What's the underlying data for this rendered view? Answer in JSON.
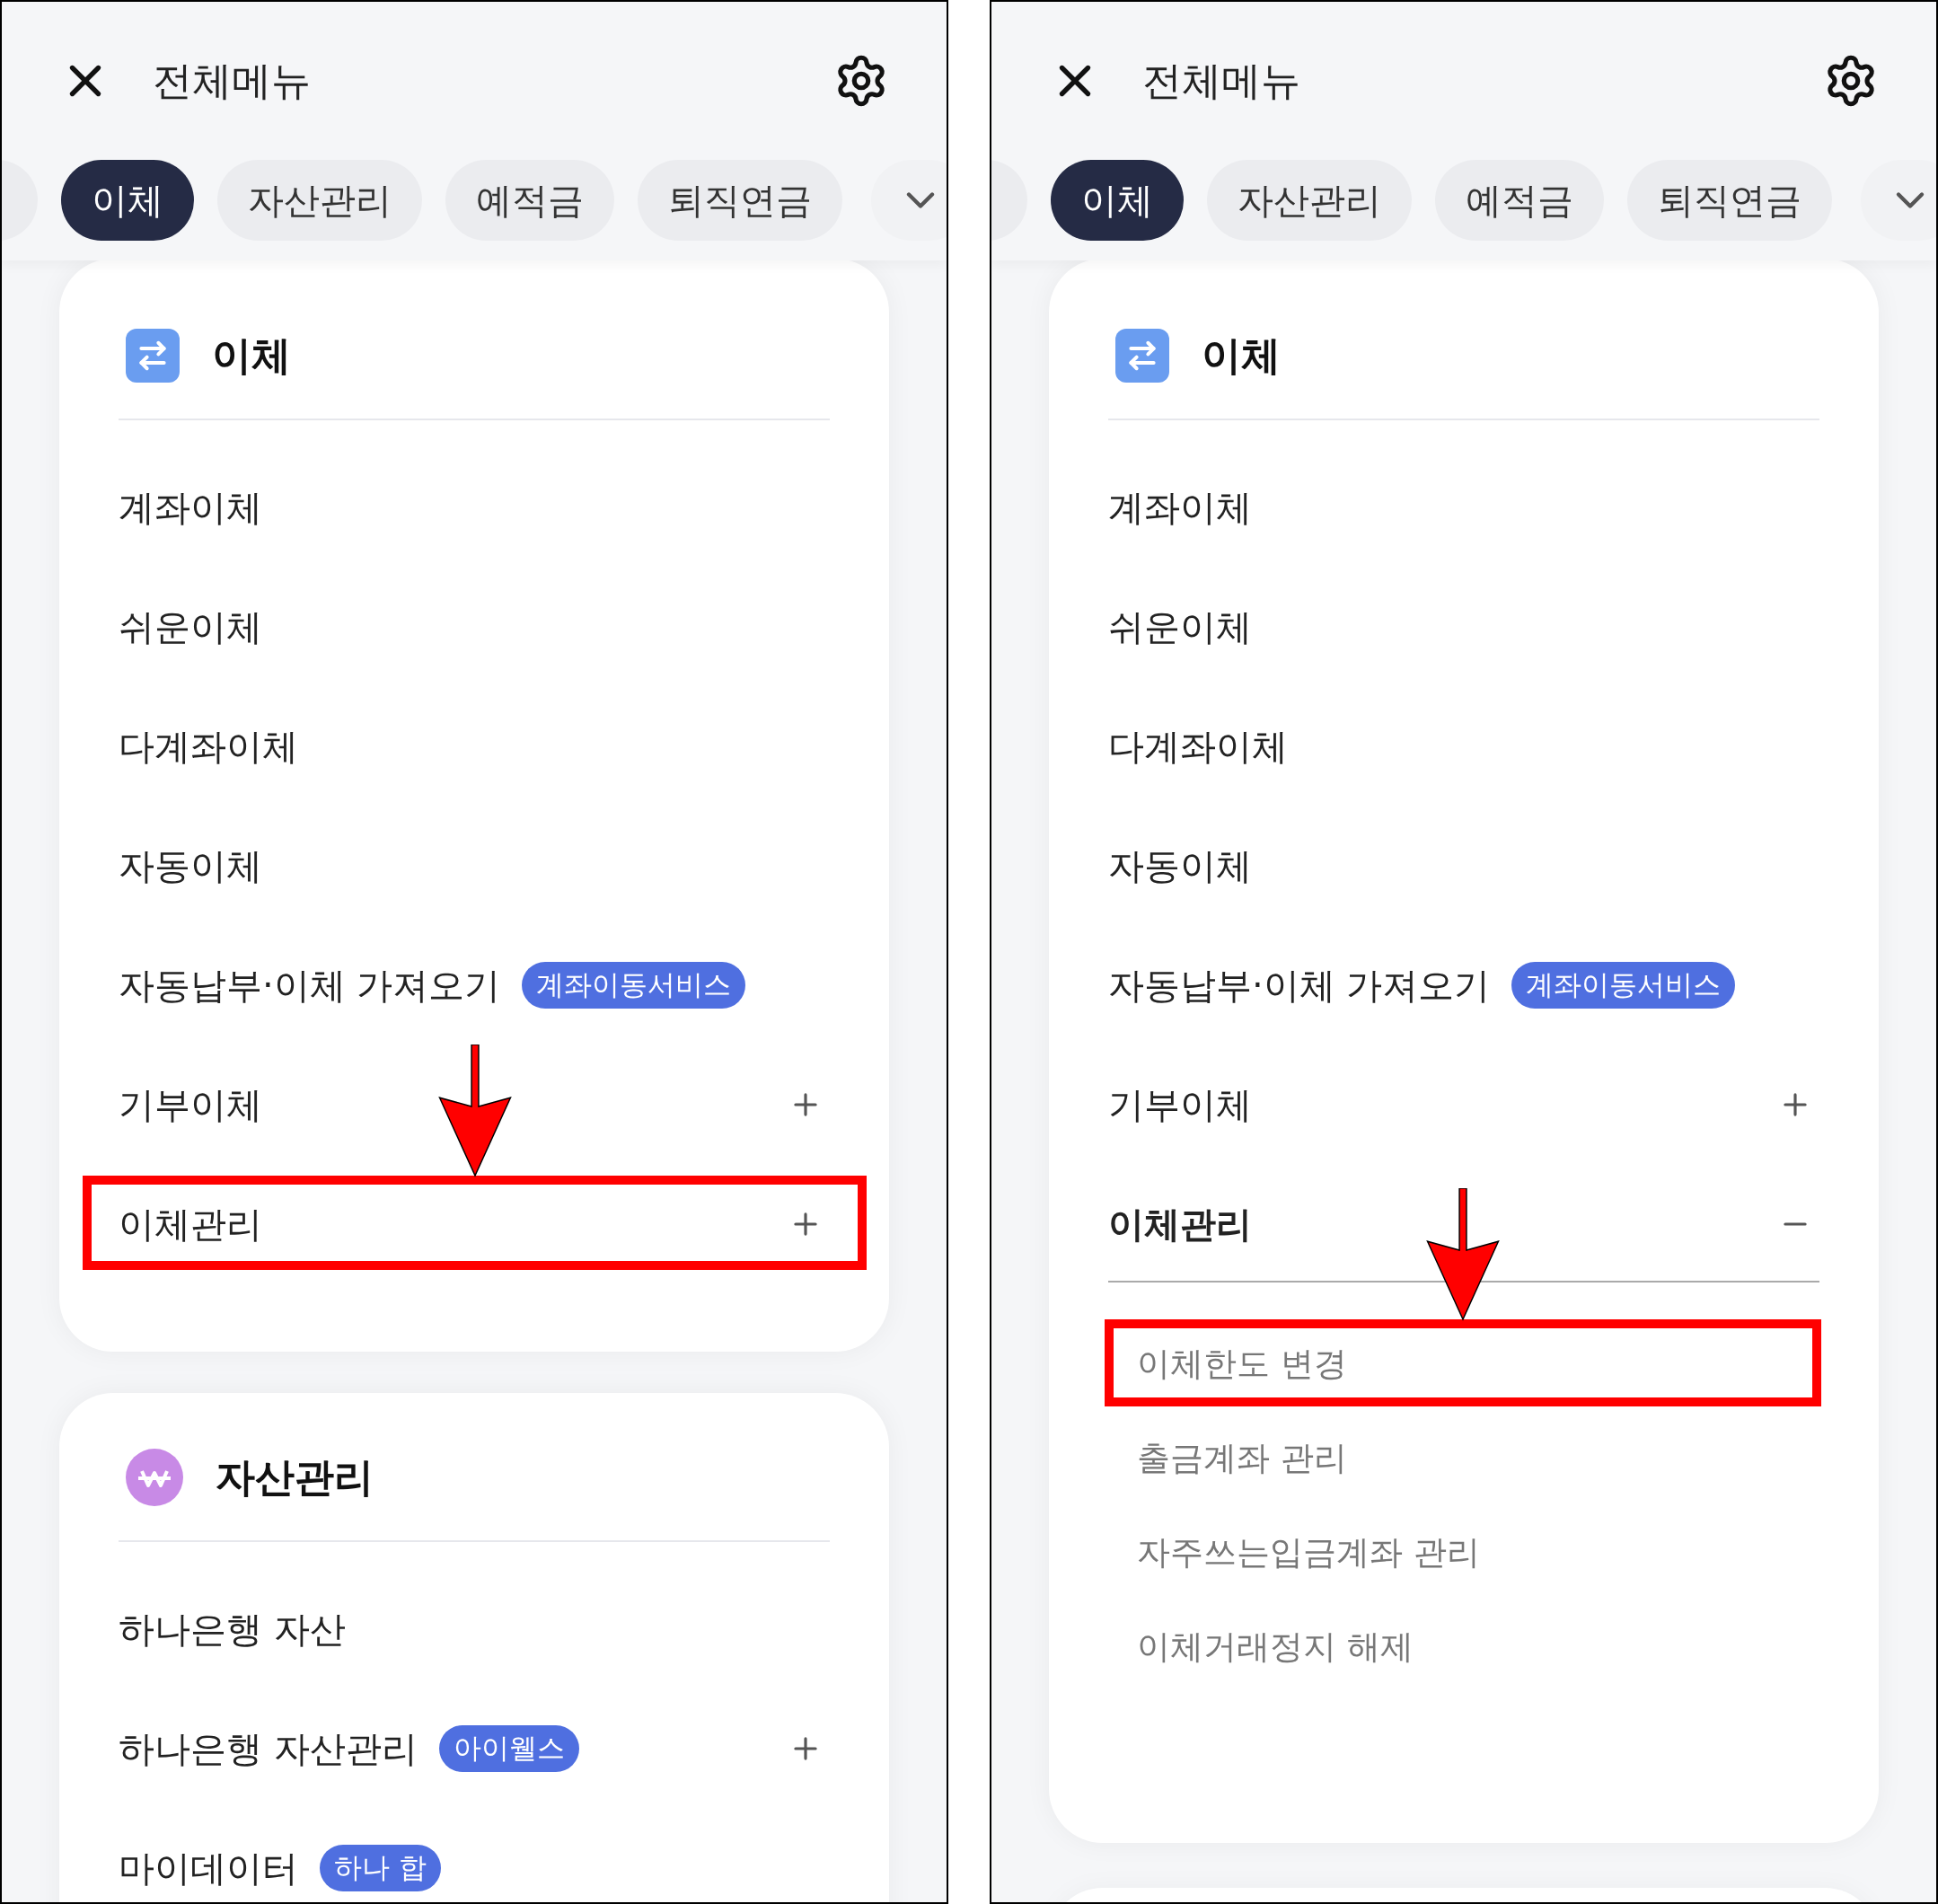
{
  "panels": [
    {
      "header": {
        "title": "전체메뉴"
      },
      "tabs": [
        {
          "kind": "cut",
          "selected": false
        },
        {
          "kind": "chip",
          "label": "이체",
          "selected": true
        },
        {
          "kind": "chip",
          "label": "자산관리",
          "selected": false
        },
        {
          "kind": "chip",
          "label": "예적금",
          "selected": false
        },
        {
          "kind": "chip",
          "label": "퇴직연금",
          "selected": false
        }
      ],
      "sections": [
        {
          "kind": "transfer",
          "title": "이체",
          "items": [
            {
              "label": "계좌이체",
              "highlighted": false
            },
            {
              "label": "쉬운이체",
              "highlighted": false
            },
            {
              "label": "다계좌이체",
              "highlighted": false
            },
            {
              "label": "자동이체",
              "highlighted": false
            },
            {
              "label": "자동납부·이체 가져오기",
              "badge": "계좌이동서비스",
              "highlighted": false
            },
            {
              "label": "기부이체",
              "expanded": false,
              "highlighted": false
            },
            {
              "label": "이체관리",
              "expanded": false,
              "highlighted": true
            }
          ]
        },
        {
          "kind": "asset",
          "title": "자산관리",
          "items": [
            {
              "label": "하나은행 자산",
              "highlighted": false
            },
            {
              "label": "하나은행 자산관리",
              "badge": "아이웰스",
              "expanded": false,
              "highlighted": false
            },
            {
              "label": "마이데이터",
              "badge": "하나 합",
              "highlighted": false
            }
          ]
        }
      ]
    },
    {
      "header": {
        "title": "전체메뉴"
      },
      "tabs": [
        {
          "kind": "cut",
          "selected": false
        },
        {
          "kind": "chip",
          "label": "이체",
          "selected": true
        },
        {
          "kind": "chip",
          "label": "자산관리",
          "selected": false
        },
        {
          "kind": "chip",
          "label": "예적금",
          "selected": false
        },
        {
          "kind": "chip",
          "label": "퇴직연금",
          "selected": false
        }
      ],
      "sections": [
        {
          "kind": "transfer",
          "title": "이체",
          "items": [
            {
              "label": "계좌이체",
              "highlighted": false
            },
            {
              "label": "쉬운이체",
              "highlighted": false
            },
            {
              "label": "다계좌이체",
              "highlighted": false
            },
            {
              "label": "자동이체",
              "highlighted": false
            },
            {
              "label": "자동납부·이체 가져오기",
              "badge": "계좌이동서비스",
              "highlighted": false
            },
            {
              "label": "기부이체",
              "expanded": false,
              "highlighted": false
            },
            {
              "label": "이체관리",
              "expanded": true,
              "highlighted": false,
              "children": [
                {
                  "label": "이체한도 변경",
                  "highlighted": true
                },
                {
                  "label": "출금계좌 관리",
                  "highlighted": false
                },
                {
                  "label": "자주쓰는입금계좌 관리",
                  "highlighted": false
                },
                {
                  "label": "이체거래정지 해제",
                  "highlighted": false
                }
              ]
            }
          ]
        },
        {
          "kind": "stub"
        }
      ]
    }
  ]
}
